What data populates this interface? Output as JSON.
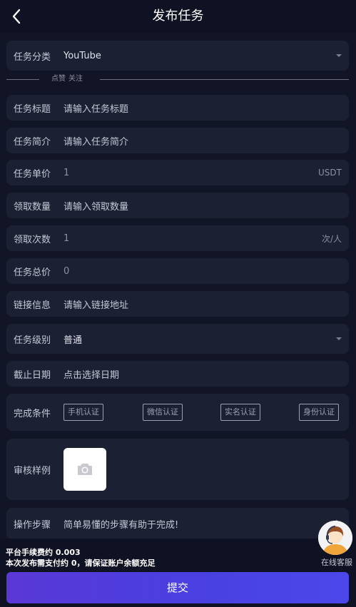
{
  "header": {
    "title": "发布任务"
  },
  "category": {
    "label": "任务分类",
    "value": "YouTube"
  },
  "divider": {
    "tags": [
      "点赞",
      "关注"
    ]
  },
  "fields": {
    "title": {
      "label": "任务标题",
      "placeholder": "请输入任务标题"
    },
    "intro": {
      "label": "任务简介",
      "placeholder": "请输入任务简介"
    },
    "unit_price": {
      "label": "任务单价",
      "value": "1",
      "unit": "USDT"
    },
    "quantity": {
      "label": "领取数量",
      "placeholder": "请输入领取数量"
    },
    "times": {
      "label": "领取次数",
      "value": "1",
      "unit": "次/人"
    },
    "total": {
      "label": "任务总价",
      "value": "0"
    },
    "link": {
      "label": "链接信息",
      "placeholder": "请输入链接地址"
    },
    "level": {
      "label": "任务级别",
      "value": "普通"
    },
    "deadline": {
      "label": "截止日期",
      "placeholder": "点击选择日期"
    }
  },
  "conditions": {
    "label": "完成条件",
    "options": [
      "手机认证",
      "微信认证",
      "实名认证",
      "身份认证"
    ]
  },
  "sample": {
    "label": "审核样例"
  },
  "steps": {
    "label": "操作步骤",
    "placeholder": "简单易懂的步骤有助于完成!"
  },
  "footer": {
    "fee": "平台手续费约 0.003",
    "notice": "本次发布需支付约 0，请保证账户余额充足",
    "submit": "提交"
  },
  "support": {
    "label": "在线客服"
  },
  "colors": {
    "accent": "#4a3fe0",
    "background": "#121526",
    "row": "#1c2033"
  }
}
